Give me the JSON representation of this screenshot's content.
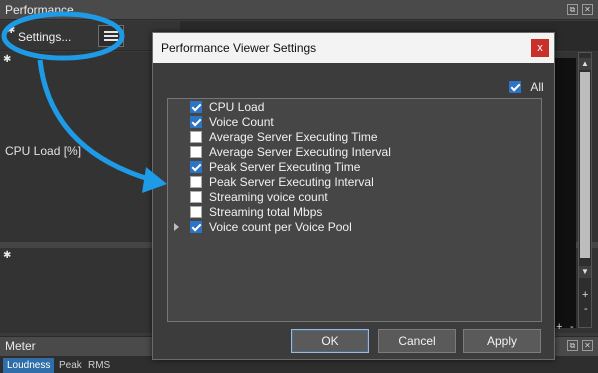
{
  "window": {
    "title": "Performance"
  },
  "toolbar": {
    "settings_label": "Settings..."
  },
  "graph": {
    "cpu_label": "CPU Load [%]"
  },
  "meter": {
    "title": "Meter",
    "tabs": [
      {
        "label": "Loudness",
        "active": true
      },
      {
        "label": "Peak",
        "active": false
      },
      {
        "label": "RMS",
        "active": false
      }
    ]
  },
  "dialog": {
    "title": "Performance Viewer Settings",
    "close_glyph": "x",
    "all_label": "All",
    "all_checked": true,
    "items": [
      {
        "label": "CPU Load",
        "checked": true
      },
      {
        "label": "Voice Count",
        "checked": true
      },
      {
        "label": "Average Server Executing Time",
        "checked": false
      },
      {
        "label": "Average Server Executing Interval",
        "checked": false
      },
      {
        "label": "Peak Server Executing Time",
        "checked": true
      },
      {
        "label": "Peak Server Executing Interval",
        "checked": false
      },
      {
        "label": "Streaming voice count",
        "checked": false
      },
      {
        "label": "Streaming total Mbps",
        "checked": false
      },
      {
        "label": "Voice count per Voice Pool",
        "checked": true,
        "expandable": true
      }
    ],
    "buttons": {
      "ok": "OK",
      "cancel": "Cancel",
      "apply": "Apply"
    }
  },
  "colors": {
    "annotation": "#1e9be6",
    "checkbox_checked": "#2d74c4",
    "close_button": "#c9302c",
    "active_tab": "#2f6ea8"
  },
  "icons": [
    "gear-icon",
    "hamburger-menu-icon",
    "close-icon",
    "checkmark-icon",
    "expand-arrow-icon"
  ]
}
